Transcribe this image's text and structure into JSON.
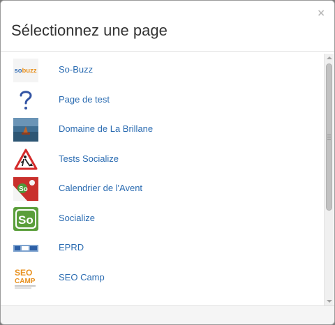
{
  "dialog": {
    "title": "Sélectionnez une page",
    "close_label": "×"
  },
  "pages": [
    {
      "label": "So-Buzz",
      "icon": "sobuzz-logo-icon",
      "logo_text": "sobuzz"
    },
    {
      "label": "Page de test",
      "icon": "question-mark-icon",
      "logo_text": "?"
    },
    {
      "label": "Domaine de La Brillane",
      "icon": "vineyard-photo-icon"
    },
    {
      "label": "Tests Socialize",
      "icon": "roadwork-sign-icon"
    },
    {
      "label": "Calendrier de l'Avent",
      "icon": "advent-calendar-icon"
    },
    {
      "label": "Socialize",
      "icon": "socialize-logo-icon",
      "logo_text": "So"
    },
    {
      "label": "EPRD",
      "icon": "eprd-logo-icon"
    },
    {
      "label": "SEO Camp",
      "icon": "seo-camp-logo-icon",
      "logo_text": "SEO CAMP"
    }
  ],
  "colors": {
    "link": "#2a6bb1",
    "title": "#333333",
    "socialize_green": "#5a9e3a",
    "seo_orange": "#e8911f"
  }
}
